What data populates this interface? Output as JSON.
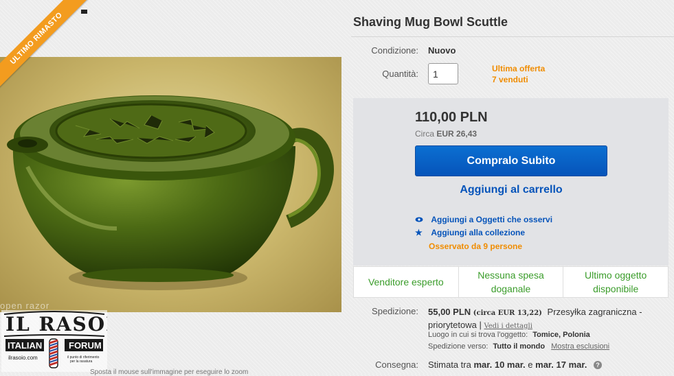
{
  "ribbon": {
    "label": "ULTIMO RIMASTO"
  },
  "watermark": {
    "text": "open razor"
  },
  "zoom_hint": "Sposta il mouse sull'immagine per eseguire lo zoom",
  "logo": {
    "text": "IL RASOIO ITALIAN FORUM"
  },
  "listing": {
    "title": "Shaving Mug Bowl Scuttle",
    "condition_label": "Condizione:",
    "condition_value": "Nuovo",
    "quantity_label": "Quantità:",
    "quantity_value": "1",
    "last_offer": "Ultima offerta",
    "sold": "7 venduti"
  },
  "price_box": {
    "price": "110,00 PLN",
    "approx_prefix": "Circa",
    "approx_value": "EUR 26,43",
    "buy_now": "Compralo Subito",
    "add_to_cart": "Aggiungi al carrello",
    "watch": "Aggiungi a Oggetti che osservi",
    "collection": "Aggiungi alla collezione",
    "watchers": "Osservato da 9 persone"
  },
  "features": [
    "Venditore esperto",
    "Nessuna spesa doganale",
    "Ultimo oggetto disponibile"
  ],
  "shipping": {
    "label": "Spedizione:",
    "cost": "55,00 PLN",
    "approx": "(circa EUR 13,22)",
    "method_line1": "Przesyłka zagraniczna -",
    "method_line2": "priorytetowa",
    "separator": "|",
    "details_link": "Vedi i dettagli",
    "location_label": "Luogo in cui si trova l'oggetto:",
    "location_value": "Tomice, Polonia",
    "ships_to_label": "Spedizione verso:",
    "ships_to_value": "Tutto il mondo",
    "exclusions_link": "Mostra esclusioni"
  },
  "delivery": {
    "label": "Consegna:",
    "prefix": "Stimata tra",
    "date_from": "mar. 10 mar.",
    "connector": "e",
    "date_to": "mar. 17 mar."
  },
  "colors": {
    "accent_blue": "#0654ba",
    "ribbon_orange": "#f39c1f",
    "feature_green": "#3a9c2a",
    "mug_green": "#3f5a12"
  }
}
